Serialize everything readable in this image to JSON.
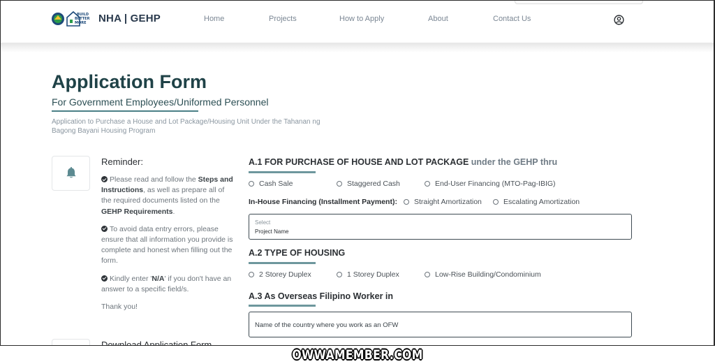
{
  "header": {
    "brand": "NHA | GEHP",
    "nav": [
      "Home",
      "Projects",
      "How to Apply",
      "About",
      "Contact Us"
    ],
    "logo_icon": "nha-build-better-more-logo",
    "user_icon": "user-circle-icon"
  },
  "hero": {
    "title": "Application Form",
    "subtitle": "For Government Employees/Uniformed Personnel",
    "description": "Application to Purchase a House and Lot Package/Housing Unit Under the Tahanan ng Bagong Bayani Housing Program"
  },
  "reminder": {
    "icon": "bell-icon",
    "title": "Reminder:",
    "item1_pre": "Please read and follow the ",
    "item1_bold1": "Steps and Instructions",
    "item1_mid": ", as well as prepare all of the required documents listed on the ",
    "item1_bold2": "GEHP Requirements",
    "item1_post": ".",
    "item2": "To avoid data entry errors, please ensure that all information you provide is complete and honest when filling out the form.",
    "item3_pre": "Kindly enter '",
    "item3_bold": "N/A",
    "item3_post": "' if you don't have an answer to a specific field/s.",
    "thanks": "Thank you!"
  },
  "download": {
    "title": "Download Application Form"
  },
  "form": {
    "a1": {
      "title": "A.1 FOR PURCHASE OF HOUSE AND LOT PACKAGE",
      "title_suffix": "under the GEHP thru",
      "options": [
        "Cash Sale",
        "Staggered Cash",
        "End-User Financing (MTO-Pag-IBIG)"
      ],
      "inhouse_label": "In-House Financing (Installment Payment):",
      "inhouse_options": [
        "Straight Amortization",
        "Escalating Amortization"
      ],
      "select_label": "Select",
      "select_value": "Project Name"
    },
    "a2": {
      "title": "A.2 TYPE OF HOUSING",
      "options": [
        "2 Storey Duplex",
        "1 Storey Duplex",
        "Low-Rise Building/Condominium"
      ]
    },
    "a3": {
      "title": "A.3 As Overseas Filipino Worker in",
      "placeholder": "Name of the country where you work as an OFW"
    }
  },
  "watermark": "OWWAMEMBER.COM",
  "colors": {
    "title": "#1f4247",
    "accent_underline": "#6e979d",
    "nav_text": "#7b8794"
  }
}
